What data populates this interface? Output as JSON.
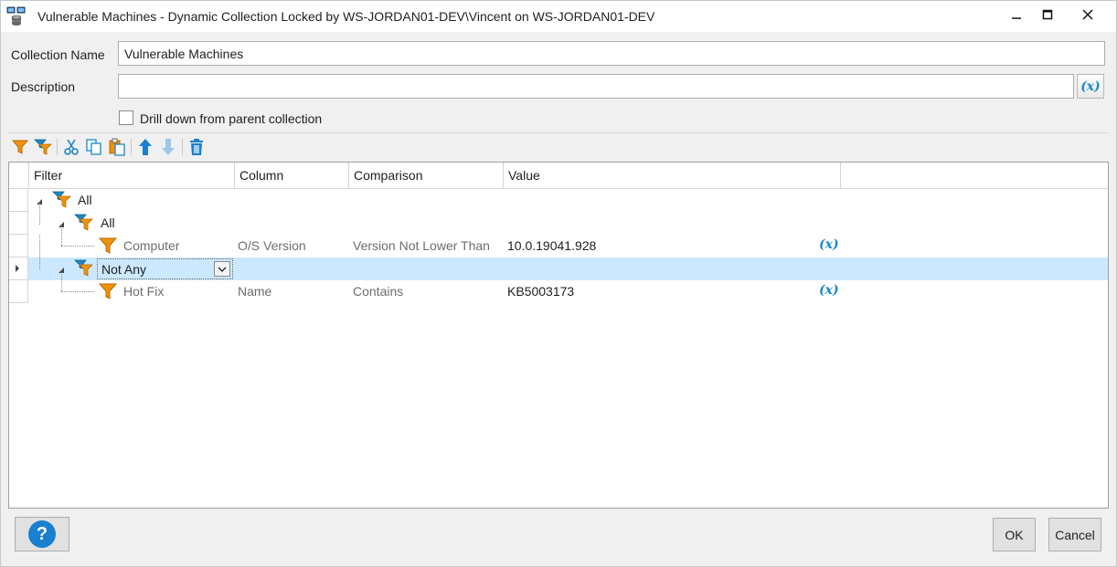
{
  "window": {
    "title": "Vulnerable Machines - Dynamic Collection Locked by WS-JORDAN01-DEV\\Vincent on WS-JORDAN01-DEV",
    "minimize_glyph": "—",
    "maximize_glyph": "☐",
    "close_glyph": "✕"
  },
  "form": {
    "collection_name_label": "Collection Name",
    "collection_name_value": "Vulnerable Machines",
    "description_label": "Description",
    "description_value": "",
    "variable_button": "(x)",
    "drill_down_label": "Drill down from parent collection",
    "drill_down_checked": false
  },
  "toolbar": {
    "icons": [
      "add-filter-icon",
      "add-filter-group-icon",
      "cut-icon",
      "copy-icon",
      "paste-icon",
      "move-up-icon",
      "move-down-icon",
      "delete-icon"
    ]
  },
  "grid": {
    "columns": [
      "Filter",
      "Column",
      "Comparison",
      "Value"
    ],
    "rows": [
      {
        "filter": "All",
        "column": "",
        "comparison": "",
        "value": "",
        "has_var": false,
        "level": 0
      },
      {
        "filter": "All",
        "column": "",
        "comparison": "",
        "value": "",
        "has_var": false,
        "level": 1
      },
      {
        "filter": "Computer",
        "column": "O/S Version",
        "comparison": "Version Not Lower Than",
        "value": "10.0.19041.928",
        "has_var": true,
        "level": 2
      },
      {
        "filter": "Not Any",
        "column": "",
        "comparison": "",
        "value": "",
        "has_var": false,
        "level": 1,
        "selected": true
      },
      {
        "filter": "Hot Fix",
        "column": "Name",
        "comparison": "Contains",
        "value": "KB5003173",
        "has_var": true,
        "level": 2
      }
    ],
    "variable_glyph": "(x)"
  },
  "buttons": {
    "help": "?",
    "ok": "OK",
    "cancel": "Cancel"
  },
  "colors": {
    "accent": "#1a88c9",
    "filter_orange": "#f0920c",
    "selection": "#cce8ff"
  }
}
